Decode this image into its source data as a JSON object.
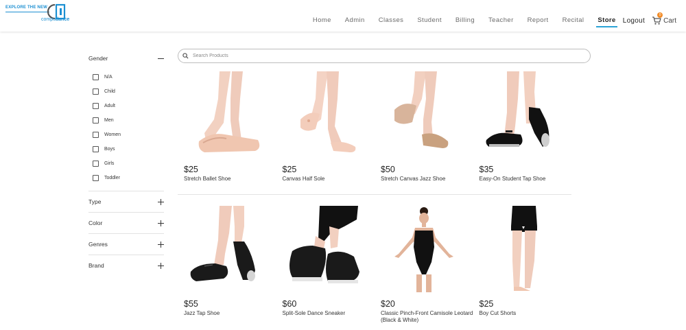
{
  "header": {
    "logo_tagline": "EXPLORE THE NEW",
    "logo_brand_prefix": "compu",
    "logo_brand_suffix": "dance",
    "nav": [
      {
        "label": "Home",
        "active": false
      },
      {
        "label": "Admin",
        "active": false
      },
      {
        "label": "Classes",
        "active": false
      },
      {
        "label": "Student",
        "active": false
      },
      {
        "label": "Billing",
        "active": false
      },
      {
        "label": "Teacher",
        "active": false
      },
      {
        "label": "Report",
        "active": false
      },
      {
        "label": "Recital",
        "active": false
      },
      {
        "label": "Store",
        "active": true
      }
    ],
    "logout_label": "Logout",
    "cart_label": "Cart",
    "cart_count": "0",
    "accent_color": "#2aa3d6",
    "badge_color": "#f28c28"
  },
  "filters": {
    "gender": {
      "title": "Gender",
      "expanded": true,
      "options": [
        "N/A",
        "Child",
        "Adult",
        "Men",
        "Women",
        "Boys",
        "Girls",
        "Toddler"
      ]
    },
    "type": {
      "title": "Type",
      "expanded": false
    },
    "color": {
      "title": "Color",
      "expanded": false
    },
    "genres": {
      "title": "Genres",
      "expanded": false
    },
    "brand": {
      "title": "Brand",
      "expanded": false
    }
  },
  "search": {
    "placeholder": "Search Products",
    "value": ""
  },
  "products": [
    {
      "price": "$25",
      "name": "Stretch Ballet Shoe",
      "image": "ballet-shoe-image"
    },
    {
      "price": "$25",
      "name": "Canvas Half Sole",
      "image": "half-sole-image"
    },
    {
      "price": "$50",
      "name": "Stretch Canvas Jazz Shoe",
      "image": "jazz-shoe-image"
    },
    {
      "price": "$35",
      "name": "Easy-On Student Tap Shoe",
      "image": "student-tap-shoe-image"
    },
    {
      "price": "$55",
      "name": "Jazz Tap Shoe",
      "image": "jazz-tap-shoe-image"
    },
    {
      "price": "$60",
      "name": "Split-Sole Dance Sneaker",
      "image": "dance-sneaker-image"
    },
    {
      "price": "$20",
      "name": "Classic Pinch-Front Camisole Leotard (Black & White)",
      "image": "camisole-leotard-image"
    },
    {
      "price": "$25",
      "name": "Boy Cut Shorts",
      "image": "boy-cut-shorts-image"
    }
  ]
}
